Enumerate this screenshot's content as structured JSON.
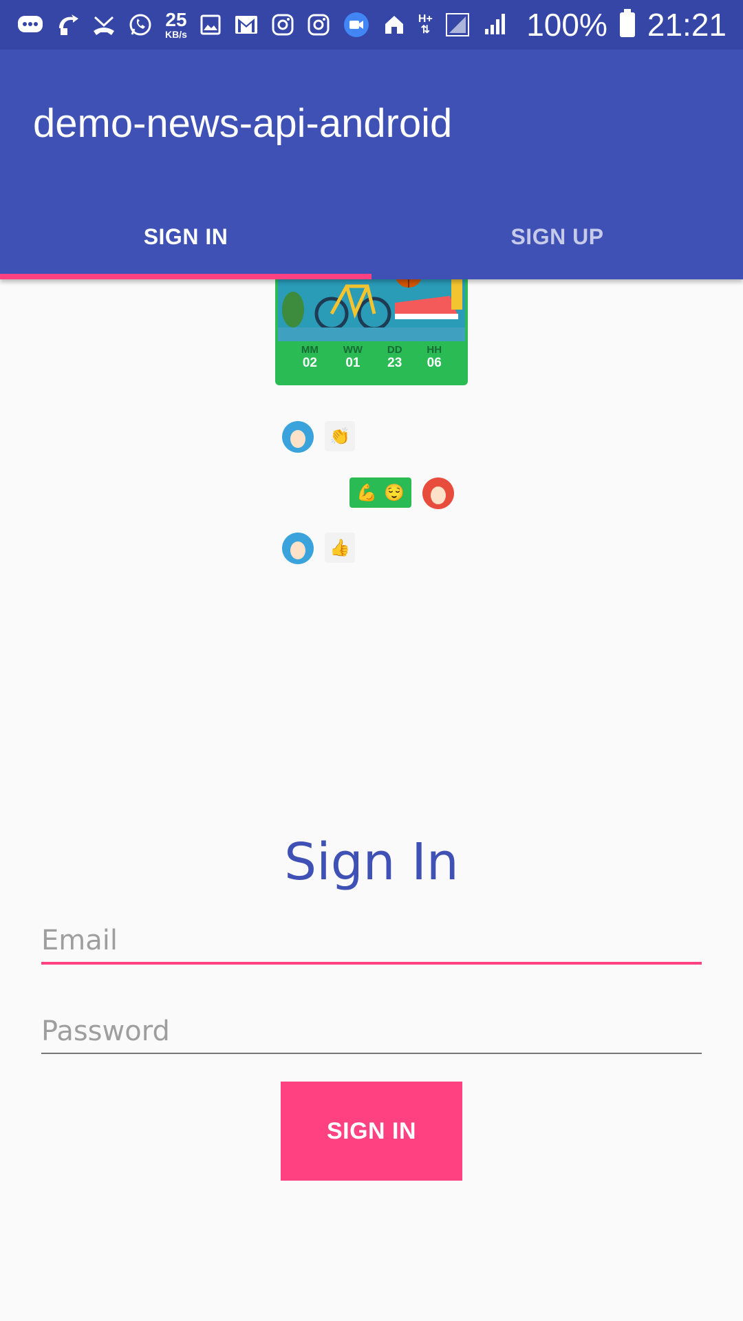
{
  "status_bar": {
    "speed_value": "25",
    "speed_unit": "KB/s",
    "network": "H+",
    "battery": "100%",
    "time": "21:21"
  },
  "app": {
    "title": "demo-news-api-android",
    "tabs": [
      {
        "label": "SIGN IN",
        "active": true
      },
      {
        "label": "SIGN UP",
        "active": false
      }
    ],
    "accent_color": "#ff4081",
    "primary_color": "#3f51b5"
  },
  "illustration": {
    "stats": [
      {
        "key": "MM",
        "value": "02"
      },
      {
        "key": "WW",
        "value": "01"
      },
      {
        "key": "DD",
        "value": "23"
      },
      {
        "key": "HH",
        "value": "06"
      }
    ]
  },
  "chat": {
    "msg1": "👏",
    "msg2a": "💪",
    "msg2b": "😌",
    "msg3": "👍"
  },
  "form": {
    "title": "Sign In",
    "email_placeholder": "Email",
    "password_placeholder": "Password",
    "submit_label": "SIGN IN"
  }
}
